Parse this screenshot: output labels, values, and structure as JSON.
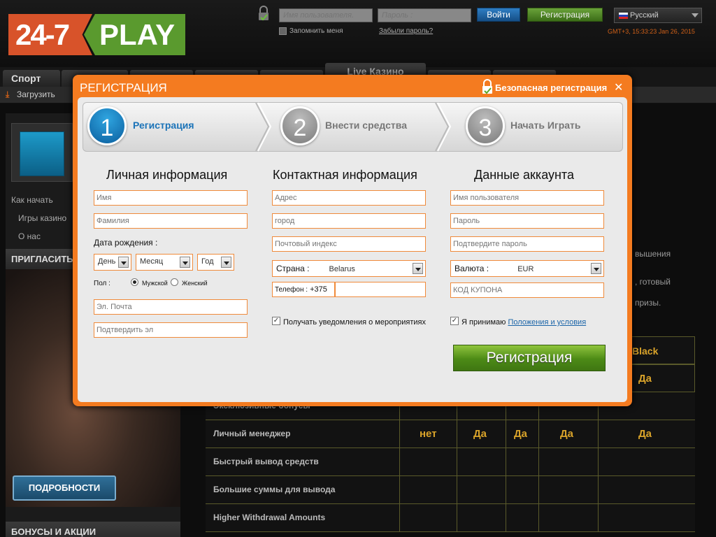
{
  "logo": {
    "left": "24-7",
    "right": "PLAY"
  },
  "header": {
    "username_placeholder": "Имя пользователя.",
    "password_placeholder": "Пароль :",
    "login_label": "Войти",
    "register_label": "Регистрация",
    "language": "Русский",
    "remember_label": "Запомнить меня",
    "forgot_label": "Забыли пароль?",
    "clock": "GMT+3, 15:33:23 Jan 26, 2015"
  },
  "nav": {
    "sport": "Спорт",
    "live_casino": "Live Казино"
  },
  "subbar": {
    "upload": "Загрузить"
  },
  "sidebar": {
    "links": [
      "Как начать",
      "Игры казино",
      "О нас"
    ],
    "invite_head": "ПРИГЛАСИТЬ",
    "more_button": "ПОДРОБНОСТИ",
    "bonus_head": "БОНУСЫ И АКЦИИ"
  },
  "background_text": {
    "line1": "вышения",
    "line2": ", готовый",
    "line3": "призы.",
    "black": "Black",
    "da": "Да"
  },
  "table": {
    "rows": [
      {
        "label": "Эксклюзивные бонусы",
        "values": []
      },
      {
        "label": "Личный менеджер",
        "values": [
          "нет",
          "Да",
          "Да",
          "Да",
          "Да"
        ]
      },
      {
        "label": "Быстрый вывод средств",
        "values": []
      },
      {
        "label": "Большие суммы для вывода",
        "values": []
      },
      {
        "label": "Higher Withdrawal Amounts",
        "values": []
      }
    ]
  },
  "modal": {
    "title": "РЕГИСТРАЦИЯ",
    "secure": "Безопасная регистрация",
    "close": "✕",
    "steps": [
      {
        "num": "1",
        "label": "Регистрация",
        "active": true
      },
      {
        "num": "2",
        "label": "Внести средства",
        "active": false
      },
      {
        "num": "3",
        "label": "Начать Играть",
        "active": false
      }
    ],
    "personal": {
      "heading": "Личная информация",
      "first_name": "Имя",
      "last_name": "Фамилия",
      "dob_label": "Дата рождения :",
      "day": "День",
      "month": "Месяц",
      "year": "Год",
      "gender_label": "Пол :",
      "male": "Мужской",
      "female": "Женский",
      "email": "Эл. Почта",
      "email_confirm": "Подтвердить эл"
    },
    "contact": {
      "heading": "Контактная информация",
      "address": "Адрес",
      "city": "город",
      "zip": "Почтовый индекс",
      "country_label": "Страна :",
      "country_value": "Belarus",
      "phone_label": "Телефон :",
      "phone_code": "+375",
      "notify_label": "Получать уведомления о мероприятиях"
    },
    "account": {
      "heading": "Данные аккаунта",
      "username": "Имя пользователя",
      "password": "Пароль",
      "password_confirm": "Подтвердите пароль",
      "currency_label": "Валюта :",
      "currency_value": "EUR",
      "coupon": "КОД КУПОНА",
      "accept_label": "Я принимаю",
      "terms_link": "Положения и условия"
    },
    "submit": "Регистрация"
  },
  "colors": {
    "accent": "#f47b20",
    "primary": "#1b73b8",
    "submit": "#4c8a16"
  }
}
